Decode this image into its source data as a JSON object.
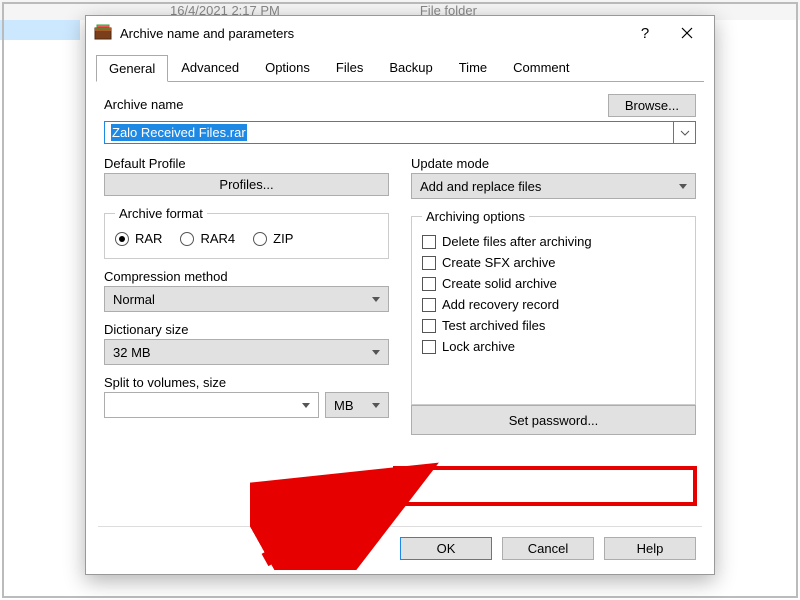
{
  "background": {
    "date": "16/4/2021 2:17 PM",
    "type": "File folder"
  },
  "dialog": {
    "title": "Archive name and parameters",
    "help_symbol": "?",
    "tabs": [
      "General",
      "Advanced",
      "Options",
      "Files",
      "Backup",
      "Time",
      "Comment"
    ],
    "active_tab_index": 0,
    "archive_name_label": "Archive name",
    "browse_label": "Browse...",
    "archive_name_value": "Zalo Received Files.rar",
    "default_profile_label": "Default Profile",
    "profiles_button": "Profiles...",
    "update_mode_label": "Update mode",
    "update_mode_value": "Add and replace files",
    "archive_format": {
      "legend": "Archive format",
      "options": [
        "RAR",
        "RAR4",
        "ZIP"
      ],
      "selected_index": 0
    },
    "compression_label": "Compression method",
    "compression_value": "Normal",
    "dictionary_label": "Dictionary size",
    "dictionary_value": "32 MB",
    "split_label": "Split to volumes, size",
    "split_value": "",
    "split_unit": "MB",
    "archiving_options": {
      "legend": "Archiving options",
      "items": [
        "Delete files after archiving",
        "Create SFX archive",
        "Create solid archive",
        "Add recovery record",
        "Test archived files",
        "Lock archive"
      ]
    },
    "set_password_label": "Set password...",
    "ok_label": "OK",
    "cancel_label": "Cancel",
    "help_label": "Help"
  }
}
